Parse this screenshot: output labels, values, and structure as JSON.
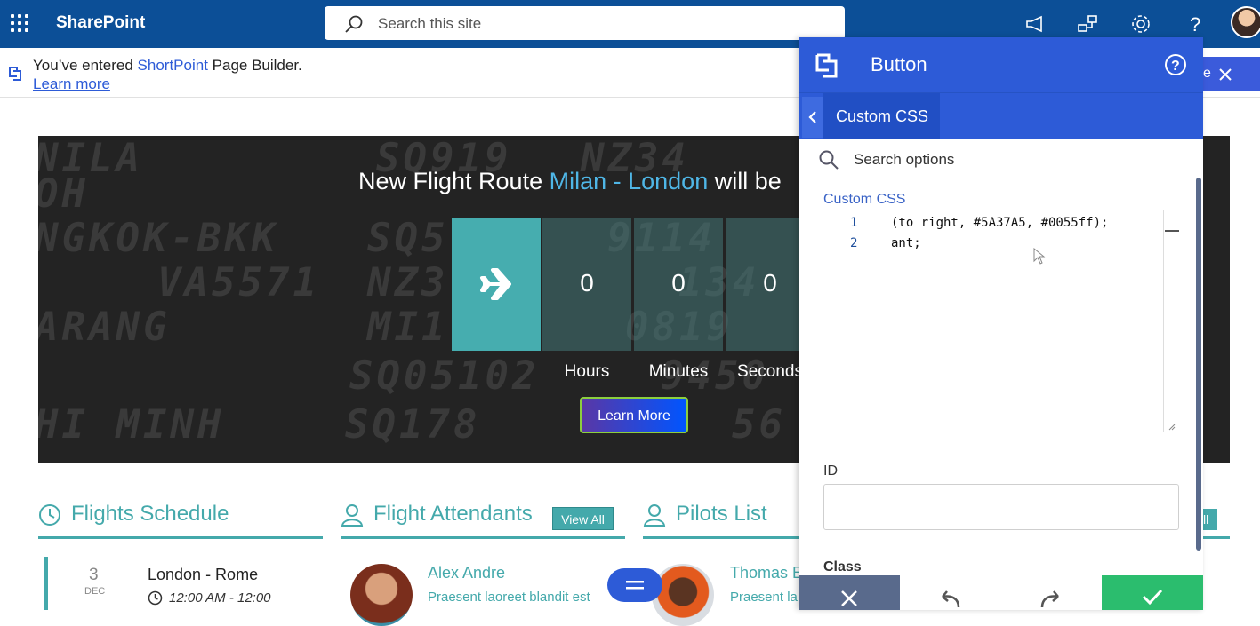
{
  "topbar": {
    "app_title": "SharePoint",
    "search_placeholder": "Search this site",
    "icons": [
      "waffle-icon",
      "search-icon",
      "megaphone-icon",
      "network-icon",
      "gear-icon",
      "help-icon",
      "avatar"
    ]
  },
  "notice": {
    "text_before": "You’ve entered ",
    "brand": "ShortPoint",
    "text_after": " Page Builder.",
    "link": "Learn more",
    "close_label": "se"
  },
  "hero": {
    "title_before": "New Flight Route ",
    "title_highlight": "Milan - London",
    "title_after": " will be",
    "countdown": [
      {
        "value": "0",
        "label": "Hours"
      },
      {
        "value": "0",
        "label": "Minutes"
      },
      {
        "value": "0",
        "label": "Seconds"
      }
    ],
    "button_label": "Learn More",
    "bg_words": [
      "NILA",
      "OH",
      "NGKOK-BKK",
      "VA5571",
      "ARANG",
      "HI MINH",
      "SQ919",
      "NZ34",
      "SQ5",
      "NZ3",
      "MI1",
      "SQ05102",
      "SQ178",
      "9114",
      "134",
      "0819",
      "9450",
      "56"
    ]
  },
  "sections": {
    "schedule": {
      "title": "Flights Schedule",
      "item": {
        "day": "3",
        "month": "DEC",
        "route": "London - Rome",
        "time": "12:00 AM - 12:00"
      }
    },
    "attendants": {
      "title": "Flight Attendants",
      "view_all": "View All",
      "person": {
        "name": "Alex Andre",
        "desc": "Praesent laoreet blandit est"
      }
    },
    "pilots": {
      "title": "Pilots List",
      "view_all_partial": "ll",
      "person": {
        "name": "Thomas E",
        "desc": "Praesent la"
      }
    }
  },
  "panel": {
    "title": "Button",
    "breadcrumb": "Custom CSS",
    "search_placeholder": "Search options",
    "css_label": "Custom CSS",
    "code_lines": [
      {
        "num": "1",
        "text": "(to right, #5A37A5, #0055ff);"
      },
      {
        "num": "2",
        "text": "ant;"
      }
    ],
    "id_label": "ID",
    "id_value": "",
    "class_label": "Class"
  },
  "colors": {
    "sp_blue": "#0c4f97",
    "panel_blue": "#2d5bd7",
    "teal": "#44a9ab",
    "gradient_start": "#5A37A5",
    "gradient_end": "#0055ff",
    "confirm_green": "#2bbd6e"
  }
}
